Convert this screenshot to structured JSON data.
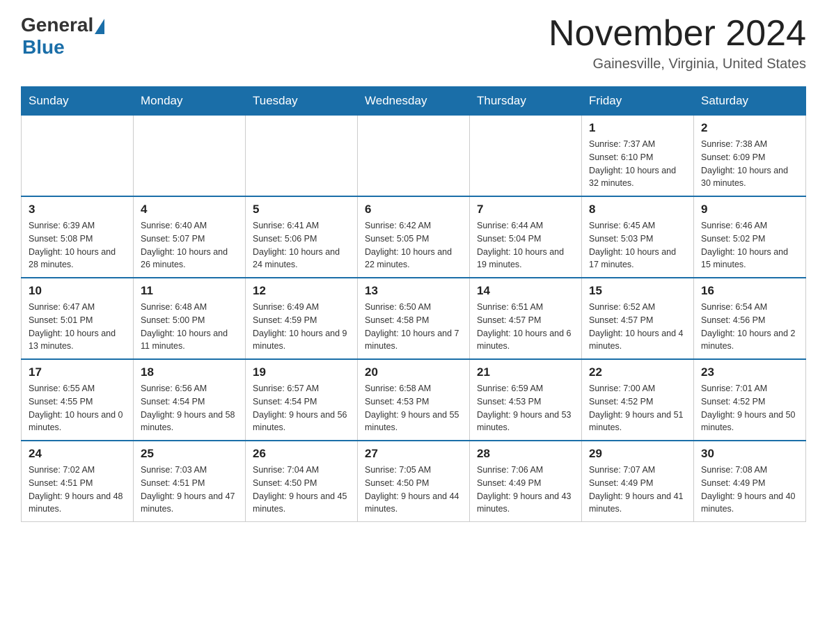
{
  "header": {
    "logo_general": "General",
    "logo_blue": "Blue",
    "month_title": "November 2024",
    "location": "Gainesville, Virginia, United States"
  },
  "weekdays": [
    "Sunday",
    "Monday",
    "Tuesday",
    "Wednesday",
    "Thursday",
    "Friday",
    "Saturday"
  ],
  "weeks": [
    [
      {
        "day": "",
        "info": ""
      },
      {
        "day": "",
        "info": ""
      },
      {
        "day": "",
        "info": ""
      },
      {
        "day": "",
        "info": ""
      },
      {
        "day": "",
        "info": ""
      },
      {
        "day": "1",
        "info": "Sunrise: 7:37 AM\nSunset: 6:10 PM\nDaylight: 10 hours and 32 minutes."
      },
      {
        "day": "2",
        "info": "Sunrise: 7:38 AM\nSunset: 6:09 PM\nDaylight: 10 hours and 30 minutes."
      }
    ],
    [
      {
        "day": "3",
        "info": "Sunrise: 6:39 AM\nSunset: 5:08 PM\nDaylight: 10 hours and 28 minutes."
      },
      {
        "day": "4",
        "info": "Sunrise: 6:40 AM\nSunset: 5:07 PM\nDaylight: 10 hours and 26 minutes."
      },
      {
        "day": "5",
        "info": "Sunrise: 6:41 AM\nSunset: 5:06 PM\nDaylight: 10 hours and 24 minutes."
      },
      {
        "day": "6",
        "info": "Sunrise: 6:42 AM\nSunset: 5:05 PM\nDaylight: 10 hours and 22 minutes."
      },
      {
        "day": "7",
        "info": "Sunrise: 6:44 AM\nSunset: 5:04 PM\nDaylight: 10 hours and 19 minutes."
      },
      {
        "day": "8",
        "info": "Sunrise: 6:45 AM\nSunset: 5:03 PM\nDaylight: 10 hours and 17 minutes."
      },
      {
        "day": "9",
        "info": "Sunrise: 6:46 AM\nSunset: 5:02 PM\nDaylight: 10 hours and 15 minutes."
      }
    ],
    [
      {
        "day": "10",
        "info": "Sunrise: 6:47 AM\nSunset: 5:01 PM\nDaylight: 10 hours and 13 minutes."
      },
      {
        "day": "11",
        "info": "Sunrise: 6:48 AM\nSunset: 5:00 PM\nDaylight: 10 hours and 11 minutes."
      },
      {
        "day": "12",
        "info": "Sunrise: 6:49 AM\nSunset: 4:59 PM\nDaylight: 10 hours and 9 minutes."
      },
      {
        "day": "13",
        "info": "Sunrise: 6:50 AM\nSunset: 4:58 PM\nDaylight: 10 hours and 7 minutes."
      },
      {
        "day": "14",
        "info": "Sunrise: 6:51 AM\nSunset: 4:57 PM\nDaylight: 10 hours and 6 minutes."
      },
      {
        "day": "15",
        "info": "Sunrise: 6:52 AM\nSunset: 4:57 PM\nDaylight: 10 hours and 4 minutes."
      },
      {
        "day": "16",
        "info": "Sunrise: 6:54 AM\nSunset: 4:56 PM\nDaylight: 10 hours and 2 minutes."
      }
    ],
    [
      {
        "day": "17",
        "info": "Sunrise: 6:55 AM\nSunset: 4:55 PM\nDaylight: 10 hours and 0 minutes."
      },
      {
        "day": "18",
        "info": "Sunrise: 6:56 AM\nSunset: 4:54 PM\nDaylight: 9 hours and 58 minutes."
      },
      {
        "day": "19",
        "info": "Sunrise: 6:57 AM\nSunset: 4:54 PM\nDaylight: 9 hours and 56 minutes."
      },
      {
        "day": "20",
        "info": "Sunrise: 6:58 AM\nSunset: 4:53 PM\nDaylight: 9 hours and 55 minutes."
      },
      {
        "day": "21",
        "info": "Sunrise: 6:59 AM\nSunset: 4:53 PM\nDaylight: 9 hours and 53 minutes."
      },
      {
        "day": "22",
        "info": "Sunrise: 7:00 AM\nSunset: 4:52 PM\nDaylight: 9 hours and 51 minutes."
      },
      {
        "day": "23",
        "info": "Sunrise: 7:01 AM\nSunset: 4:52 PM\nDaylight: 9 hours and 50 minutes."
      }
    ],
    [
      {
        "day": "24",
        "info": "Sunrise: 7:02 AM\nSunset: 4:51 PM\nDaylight: 9 hours and 48 minutes."
      },
      {
        "day": "25",
        "info": "Sunrise: 7:03 AM\nSunset: 4:51 PM\nDaylight: 9 hours and 47 minutes."
      },
      {
        "day": "26",
        "info": "Sunrise: 7:04 AM\nSunset: 4:50 PM\nDaylight: 9 hours and 45 minutes."
      },
      {
        "day": "27",
        "info": "Sunrise: 7:05 AM\nSunset: 4:50 PM\nDaylight: 9 hours and 44 minutes."
      },
      {
        "day": "28",
        "info": "Sunrise: 7:06 AM\nSunset: 4:49 PM\nDaylight: 9 hours and 43 minutes."
      },
      {
        "day": "29",
        "info": "Sunrise: 7:07 AM\nSunset: 4:49 PM\nDaylight: 9 hours and 41 minutes."
      },
      {
        "day": "30",
        "info": "Sunrise: 7:08 AM\nSunset: 4:49 PM\nDaylight: 9 hours and 40 minutes."
      }
    ]
  ]
}
